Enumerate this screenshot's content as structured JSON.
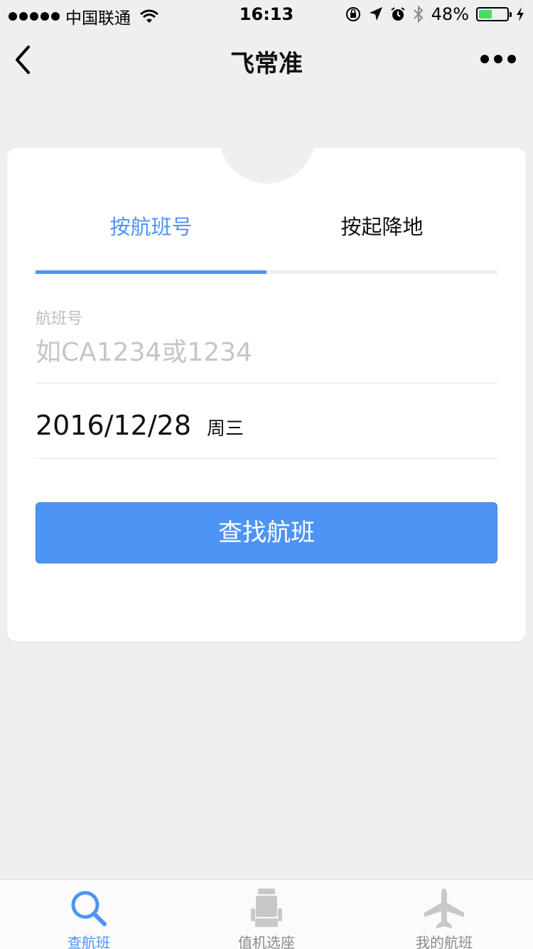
{
  "status_bar": {
    "carrier": "中国联通",
    "time": "16:13",
    "battery_percent": "48%",
    "battery_level": 0.48,
    "icons": [
      "signal-icon",
      "wifi-icon",
      "orientation-lock-icon",
      "location-icon",
      "alarm-icon",
      "bluetooth-icon",
      "battery-icon",
      "charging-icon"
    ]
  },
  "nav": {
    "title": "飞常准",
    "back_icon": "chevron-left-icon",
    "more_icon": "more-dots-icon"
  },
  "search_card": {
    "tabs": [
      {
        "label": "按航班号",
        "active": true
      },
      {
        "label": "按起降地",
        "active": false
      }
    ],
    "flight_field": {
      "label": "航班号",
      "value": "",
      "placeholder": "如CA1234或1234"
    },
    "date": {
      "value": "2016/12/28",
      "weekday": "周三"
    },
    "search_button": "查找航班"
  },
  "tab_bar": {
    "items": [
      {
        "label": "查航班",
        "icon": "search-icon",
        "active": true
      },
      {
        "label": "值机选座",
        "icon": "seat-icon",
        "active": false
      },
      {
        "label": "我的航班",
        "icon": "airplane-icon",
        "active": false
      }
    ]
  },
  "colors": {
    "accent": "#4d94f5",
    "background": "#efefef",
    "inactive": "#8a8a8a"
  }
}
